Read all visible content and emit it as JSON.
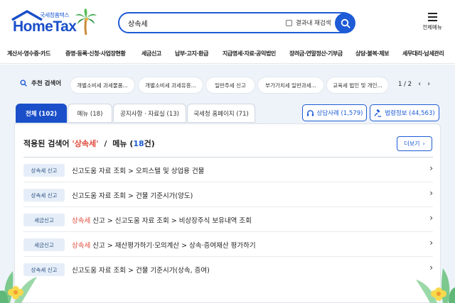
{
  "header": {
    "logo_small": "국세청홈택스",
    "logo_big": "HomeTax",
    "search_value": "상속세",
    "rescan_label": "결과내 재검색",
    "allmenu_label": "전체메뉴"
  },
  "nav": [
    "계산서·영수증·카드",
    "증명·등록·신청·사업장현황",
    "세금신고",
    "납부·고지·환급",
    "지급명세·자료·공익법인",
    "장려금·연말정산·기부금",
    "상담·불복·제보",
    "세무대리·납세관리"
  ],
  "recommend": {
    "label": "추천 검색어",
    "chips": [
      "개별소비세 과세물품...",
      "개별소비세 과세유흥...",
      "일반주세 신고",
      "부가가치세 일반과세...",
      "교육세 법인 및 개인..."
    ],
    "page": "1 / 2"
  },
  "tabs": [
    "전체 (102)",
    "메뉴 (18)",
    "공지사항 · 자료실 (13)",
    "국세청 홈페이지 (71)"
  ],
  "side_buttons": [
    "상담사례 (1,579)",
    "법령정보 (44,563)"
  ],
  "panel": {
    "title_prefix": "적용된 검색어",
    "keyword": "'상속세'",
    "category": "메뉴",
    "count_open": "(",
    "count": "18",
    "count_close": "건)",
    "more": "더보기"
  },
  "rows": [
    {
      "badge": "상속세 신고",
      "kw": "",
      "text": "신고도움 자료 조회 > 오피스텔 및 상업용 건물"
    },
    {
      "badge": "상속세 신고",
      "kw": "",
      "text": "신고도움 자료 조회 > 건물 기준시가(양도)"
    },
    {
      "badge": "세금신고",
      "kw": "상속세",
      "text": " 신고 > 신고도움 자료 조회 > 비상장주식 보유내역 조회"
    },
    {
      "badge": "세금신고",
      "kw": "상속세",
      "text": " 신고 > 재산평가하기·모의계산 > 상속·증여재산 평가하기"
    },
    {
      "badge": "상속세 신고",
      "kw": "",
      "text": "신고도움 자료 조회 > 건물 기준시가(상속, 증여)"
    }
  ],
  "icons": {
    "roof": "house-roof-icon",
    "palm": "palm-tree-icon",
    "search": "search-icon",
    "menu": "hamburger-menu-icon",
    "headset": "headset-icon",
    "law": "gavel-icon",
    "chevron": "chevron-right-icon",
    "leaf": "leaf-decoration-icon",
    "flower": "flower-decoration-icon"
  },
  "colors": {
    "brand": "#1e5bd6",
    "keyword": "#e04a3a",
    "background": "#eef3f9"
  }
}
